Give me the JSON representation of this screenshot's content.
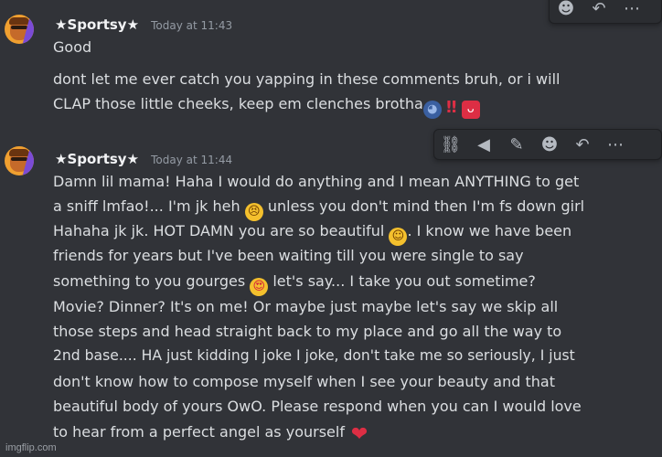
{
  "messages": [
    {
      "username": "★Sportsy★",
      "timestamp": "Today at 11:43",
      "lines": [
        "Good",
        "dont let me ever catch you yapping in these comments bruh, or i will",
        "CLAP those little cheeks, keep em clenches brotha"
      ]
    },
    {
      "username": "★Sportsy★",
      "timestamp": "Today at 11:44",
      "lines": [
        "Damn lil mama! Haha I would do anything and I mean ANYTHING to get",
        "a sniff lmfao!... I'm jk heh",
        " unless you don't mind then I'm fs down girl",
        "Hahaha jk jk. HOT DAMN you are so beautiful",
        ". I know we have been",
        "friends for years but I've been waiting till you were single to say",
        "something to you gourges",
        " let's say... I take you out sometime?",
        "Movie? Dinner? It's on me! Or maybe just maybe let's say we skip all",
        "those steps and head straight back to my place and go all the way to",
        "2nd base.... HA just kidding I joke I joke, don't take me so seriously, I just",
        "don't know how to compose myself when I see your beauty and that",
        "beautiful body of yours OwO. Please respond when you can I would love",
        "to hear from a perfect angel as yourself"
      ]
    }
  ],
  "emojis": {
    "speaking_head": "speaking-head-icon",
    "double_exclamation": "‼",
    "tongue": "tongue-icon",
    "confounded": "😣",
    "relieved": "☺",
    "heart_eyes": "😍",
    "heart": "❤"
  },
  "watermark": "imgflip.com",
  "colors": {
    "background": "#313338",
    "username": "#f2f3f5",
    "timestamp": "#949ba4",
    "text": "#dbdee1"
  }
}
